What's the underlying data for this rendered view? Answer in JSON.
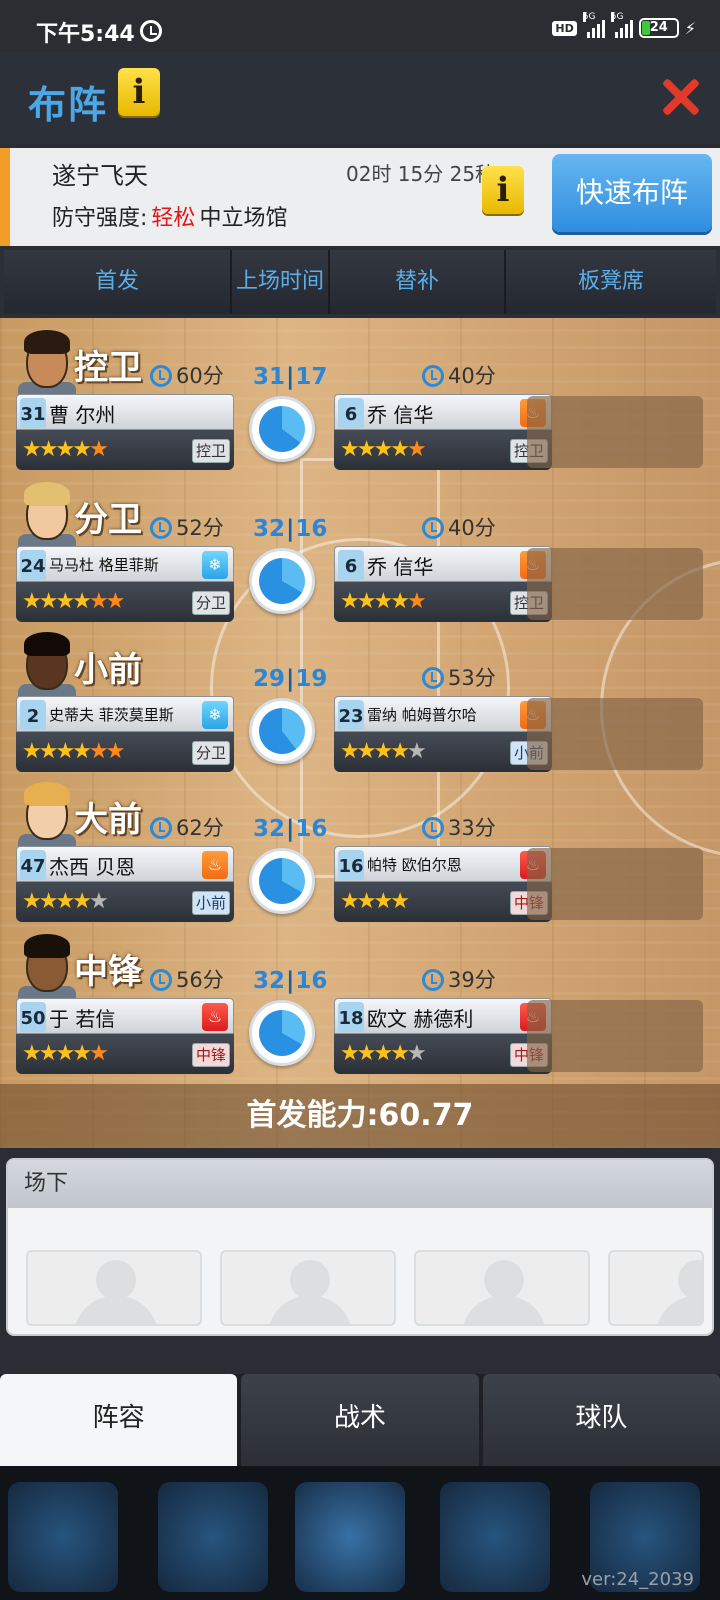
{
  "status_bar": {
    "time": "下午5:44",
    "hd": "HD",
    "net1": "5G",
    "net2": "5G",
    "battery": "24",
    "battery_level": 0.24
  },
  "header": {
    "title": "布阵"
  },
  "match": {
    "opponent": "遂宁飞天",
    "countdown": "02时 15分 25秒",
    "defense_label": "防守强度:",
    "defense_level": "轻松",
    "venue": "中立场馆",
    "quick_button": "快速布阵"
  },
  "columns": [
    "首发",
    "上场时间",
    "替补",
    "板凳席"
  ],
  "rows": [
    {
      "position": "控卫",
      "starter_time": "60分",
      "starter": {
        "number": "31",
        "name": "曹 尔州",
        "stars": "4o1",
        "pos": "控卫",
        "badge": ""
      },
      "split_starter": "31",
      "split_sub": "17",
      "sub_time": "40分",
      "sub": {
        "number": "6",
        "name": "乔 信华",
        "stars": "4h1",
        "pos": "控卫",
        "badge": "fire"
      }
    },
    {
      "position": "分卫",
      "starter_time": "52分",
      "starter": {
        "number": "24",
        "name": "马马杜 格里菲斯",
        "stars": "4h2",
        "pos": "分卫",
        "badge": "ice"
      },
      "split_starter": "32",
      "split_sub": "16",
      "sub_time": "40分",
      "sub": {
        "number": "6",
        "name": "乔 信华",
        "stars": "4h1",
        "pos": "控卫",
        "badge": "fire"
      }
    },
    {
      "position": "小前",
      "starter_time": "",
      "starter": {
        "number": "2",
        "name": "史蒂夫 菲茨莫里斯",
        "stars": "4h2",
        "pos": "分卫",
        "badge": "ice"
      },
      "split_starter": "29",
      "split_sub": "19",
      "sub_time": "53分",
      "sub": {
        "number": "23",
        "name": "雷纳 帕姆普尔哈",
        "stars": "4e1",
        "pos": "小前",
        "badge": "fire"
      }
    },
    {
      "position": "大前",
      "starter_time": "62分",
      "starter": {
        "number": "47",
        "name": "杰西 贝恩",
        "stars": "4e1",
        "pos": "小前",
        "badge": "fire"
      },
      "split_starter": "32",
      "split_sub": "16",
      "sub_time": "33分",
      "sub": {
        "number": "16",
        "name": "帕特 欧伯尔恩",
        "stars": "4h0",
        "pos": "中锋",
        "badge": "hot"
      }
    },
    {
      "position": "中锋",
      "starter_time": "56分",
      "starter": {
        "number": "50",
        "name": "于 若信",
        "stars": "4o1",
        "pos": "中锋",
        "badge": "hot"
      },
      "split_starter": "32",
      "split_sub": "16",
      "sub_time": "39分",
      "sub": {
        "number": "18",
        "name": "欧文 赫德利",
        "stars": "4e1",
        "pos": "中锋",
        "badge": "hot"
      }
    }
  ],
  "lineup_power": "首发能力:60.77",
  "bench": {
    "title": "场下"
  },
  "bottom_tabs": [
    "阵容",
    "战术",
    "球队"
  ],
  "version": "ver:24_2039",
  "colors": {
    "accent": "#4ba7e6",
    "danger": "#e21818",
    "court": "#d8ae7c"
  }
}
